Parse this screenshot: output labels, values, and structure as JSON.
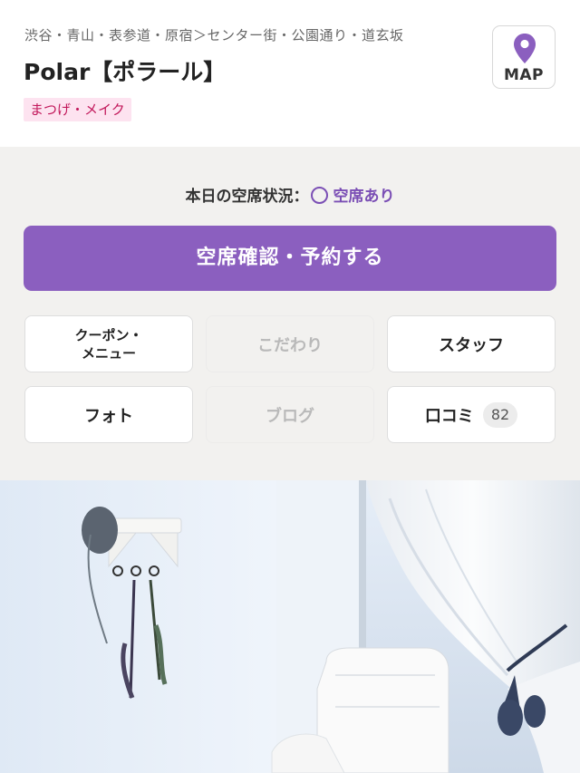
{
  "header": {
    "area": "渋谷・青山・表参道・原宿＞センター街・公園通り・道玄坂",
    "shop_name": "Polar【ポラール】",
    "genre": "まつげ・メイク",
    "map_label": "MAP",
    "map_icon": "map-pin-icon"
  },
  "availability": {
    "label": "本日の空席状況：",
    "symbol": "◯",
    "value": "空席あり"
  },
  "reserve_button": "空席確認・予約する",
  "nav": {
    "coupon_line1": "クーポン・",
    "coupon_line2": "メニュー",
    "kodawari": "こだわり",
    "staff": "スタッフ",
    "photo": "フォト",
    "blog": "ブログ",
    "reviews": "口コミ",
    "reviews_count": "82"
  },
  "colors": {
    "accent": "#8b5fbf",
    "tag_bg": "#fde3f0",
    "tag_text": "#c2185b",
    "panel_bg": "#f2f1ef"
  }
}
